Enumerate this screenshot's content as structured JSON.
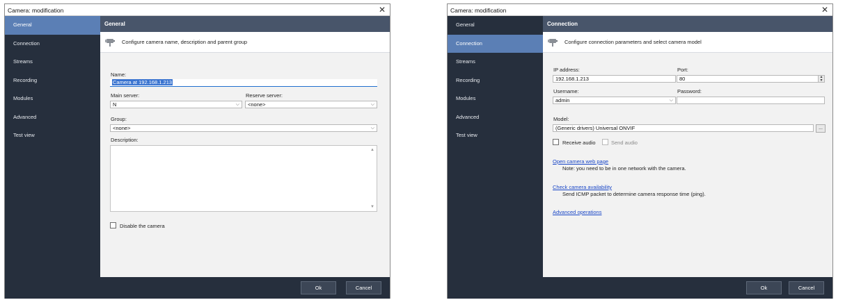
{
  "left": {
    "title": "Camera: modification",
    "nav": [
      "General",
      "Connection",
      "Streams",
      "Recording",
      "Modules",
      "Advanced",
      "Test view"
    ],
    "header": "General",
    "subtitle": "Configure camera name, description and parent group",
    "name_label": "Name:",
    "name_value": "Camera at 192.168.1.213",
    "main_server_label": "Main server:",
    "main_server_value": "N",
    "reserve_server_label": "Reserve server:",
    "reserve_server_value": "<none>",
    "group_label": "Group:",
    "group_value": "<none>",
    "description_label": "Description:",
    "description_value": "",
    "disable_label": "Disable the camera",
    "ok": "Ok",
    "cancel": "Cancel"
  },
  "right": {
    "title": "Camera: modification",
    "nav": [
      "General",
      "Connection",
      "Streams",
      "Recording",
      "Modules",
      "Advanced",
      "Test view"
    ],
    "header": "Connection",
    "subtitle": "Configure connection parameters and select camera model",
    "ip_label": "IP address:",
    "ip_value": "192.168.1.213",
    "port_label": "Port:",
    "port_value": "80",
    "username_label": "Username:",
    "username_value": "admin",
    "password_label": "Password:",
    "password_value": "",
    "model_label": "Model:",
    "model_value": "(Generic drivers) Universal ONVIF",
    "model_btn": "...",
    "receive_audio": "Receive audio",
    "send_audio": "Send audio",
    "open_web": "Open camera web page",
    "open_web_note": "Note: you need to be in one network with the camera.",
    "check_avail": "Check camera availability",
    "check_avail_note": "Send ICMP packet to determine camera response time (ping).",
    "advanced_ops": "Advanced operations",
    "ok": "Ok",
    "cancel": "Cancel"
  },
  "colors": {
    "sidebar": "#262f3d",
    "active_nav": "#5b7fb5",
    "header": "#48556a",
    "link": "#1a47c7"
  },
  "icons": {
    "close": "close-icon",
    "camera": "camera-icon",
    "chevron": "chevron-down-icon"
  }
}
